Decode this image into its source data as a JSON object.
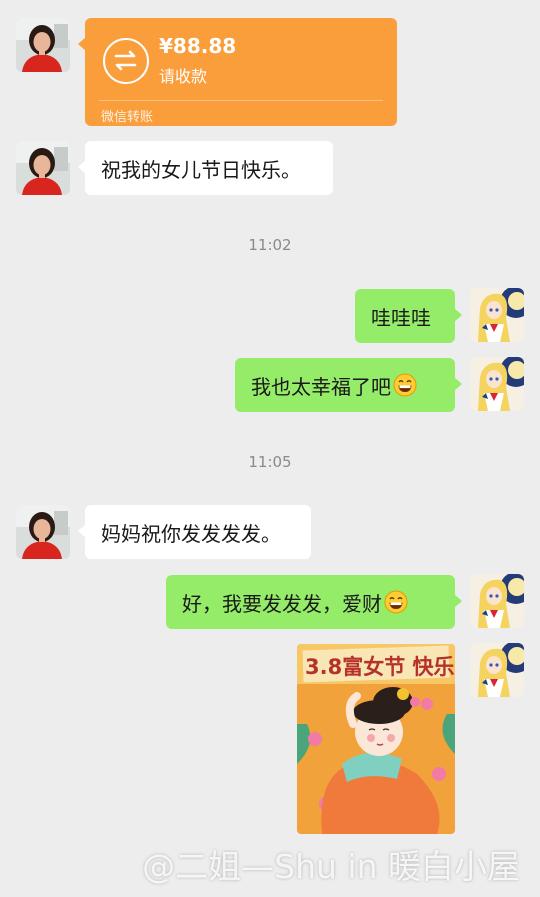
{
  "transfer": {
    "amount": "¥88.88",
    "subtitle": "请收款",
    "footer": "微信转账",
    "color": "#fa9d3b"
  },
  "messages": {
    "m1": "祝我的女儿节日快乐。",
    "time1": "11:02",
    "m2": "哇哇哇",
    "m3": "我也太幸福了吧",
    "time2": "11:05",
    "m4": "妈妈祝你发发发发。",
    "m5": "好，我要发发发，爱财"
  },
  "sticker": {
    "title": "3.8富女节 快乐"
  },
  "watermark": "@二姐—Shu in 暖白小屋",
  "colors": {
    "background": "#ededed",
    "own_bubble": "#95ec69",
    "other_bubble": "#ffffff"
  }
}
